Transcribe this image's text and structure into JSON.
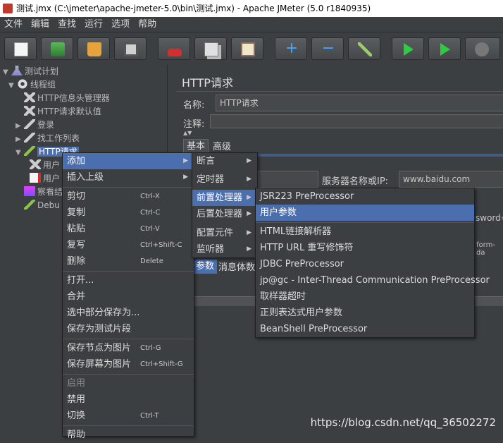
{
  "window": {
    "title": "测试.jmx (C:\\jmeter\\apache-jmeter-5.0\\bin\\测试.jmx) - Apache JMeter (5.0 r1840935)"
  },
  "menubar": {
    "items": [
      "文件",
      "编辑",
      "查找",
      "运行",
      "选项",
      "帮助"
    ]
  },
  "toolbar": {
    "icons": [
      "new-icon",
      "templates-icon",
      "open-icon",
      "save-icon",
      "cut-icon",
      "copy-icon",
      "paste-icon",
      "expand-icon",
      "collapse-icon",
      "toggle-icon",
      "start-icon",
      "start-no-pause-icon",
      "stop-icon"
    ]
  },
  "tree": {
    "nodes": [
      {
        "label": "测试计划"
      },
      {
        "label": "线程组"
      },
      {
        "label": "HTTP信息头管理器"
      },
      {
        "label": "HTTP请求默认值"
      },
      {
        "label": "登录"
      },
      {
        "label": "找工作列表"
      },
      {
        "label": "HTTP请求"
      },
      {
        "label": "用户"
      },
      {
        "label": "用户"
      },
      {
        "label": "察看结"
      },
      {
        "label": "Debu"
      }
    ]
  },
  "editor": {
    "title": "HTTP请求",
    "name_label": "名称:",
    "name_value": "HTTP请求",
    "comment_label": "注释:",
    "tab_basic": "基本",
    "tab_advanced": "高级",
    "server_label": "服务器名称或IP:",
    "server_value": "www.baidu.com",
    "password_fragment": "sword=",
    "formdata_fragment": "form-da",
    "tab_params": "参数",
    "tab_body": "消息体数"
  },
  "context_menu": {
    "add": "添加",
    "insert_parent": "插入上级",
    "cut": "剪切",
    "cut_sc": "Ctrl-X",
    "copy": "复制",
    "copy_sc": "Ctrl-C",
    "paste": "粘贴",
    "paste_sc": "Ctrl-V",
    "duplicate": "复写",
    "duplicate_sc": "Ctrl+Shift-C",
    "delete": "删除",
    "delete_sc": "Delete",
    "open": "打开...",
    "merge": "合并",
    "save_selection": "选中部分保存为...",
    "save_fragment": "保存为测试片段",
    "save_node_image": "保存节点为图片",
    "save_node_image_sc": "Ctrl-G",
    "save_screen_image": "保存屏幕为图片",
    "save_screen_image_sc": "Ctrl+Shift-G",
    "enable": "启用",
    "disable": "禁用",
    "toggle": "切换",
    "toggle_sc": "Ctrl-T",
    "help": "帮助"
  },
  "add_submenu": {
    "assertions": "断言",
    "timers": "定时器",
    "preprocessors": "前置处理器",
    "postprocessors": "后置处理器",
    "config": "配置元件",
    "listeners": "监听器"
  },
  "pre_submenu": {
    "items": [
      "JSR223 PreProcessor",
      "用户参数",
      "HTML链接解析器",
      "HTTP URL 重写修饰符",
      "JDBC PreProcessor",
      "jp@gc - Inter-Thread Communication PreProcessor",
      "取样器超时",
      "正则表达式用户参数",
      "BeanShell PreProcessor"
    ]
  },
  "watermark": "https://blog.csdn.net/qq_36502272",
  "colors": {
    "selection": "#4b6eaf",
    "background": "#3c3f41"
  }
}
